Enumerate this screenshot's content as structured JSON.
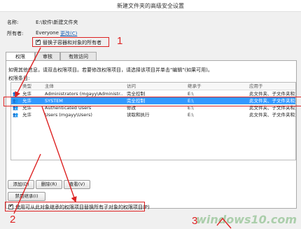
{
  "window": {
    "title": "新建文件夹的高级安全设置"
  },
  "general": {
    "name_label": "名称:",
    "name_value": "E:\\软件\\新建文件夹",
    "owner_label": "所有者:",
    "owner_value": "Everyone",
    "change_link": "更改(C)",
    "replace_owner_label": "替换子容器和对象的所有者",
    "replace_owner_checked": true
  },
  "tabs": [
    {
      "label": "权限",
      "active": true
    },
    {
      "label": "审核",
      "active": false
    },
    {
      "label": "有效访问",
      "active": false
    }
  ],
  "permissions": {
    "info_text": "如需其他信息，请双击权限项目。若要修改权限项目，请选择该项目并单击\"编辑\"(如果可用)。",
    "list_label": "权限条目:",
    "columns": [
      "类型",
      "主体",
      "访问",
      "继承于",
      "应用于"
    ],
    "rows": [
      {
        "type": "允许",
        "principal": "Administrators (mgayy\\Administr...",
        "access": "完全控制",
        "inherited": "E:\\",
        "applies": "此文件夹、子文件夹和文件",
        "selected": false
      },
      {
        "type": "允许",
        "principal": "SYSTEM",
        "access": "完全控制",
        "inherited": "E:\\",
        "applies": "此文件夹、子文件夹和文件",
        "selected": true
      },
      {
        "type": "允许",
        "principal": "Authenticated Users",
        "access": "修改",
        "inherited": "E:\\",
        "applies": "此文件夹、子文件夹和文件",
        "selected": false
      },
      {
        "type": "允许",
        "principal": "Users (mgayy\\Users)",
        "access": "读取和执行",
        "inherited": "E:\\",
        "applies": "此文件夹、子文件夹和文件",
        "selected": false
      }
    ],
    "add_button": "添加(D)",
    "delete_button": "删除(R)",
    "view_button": "查看(V)",
    "disable_inherit_button": "禁用继承(I)",
    "replace_all_label": "使用可从此对象继承的权限项目替换所有子对象的权限项目(P)",
    "replace_all_checked": true
  },
  "annotations": {
    "one": "1",
    "two": "2",
    "three": "3"
  },
  "watermark": "windows10.com",
  "colors": {
    "accent": "#3399ff",
    "annotation": "#dd2222"
  }
}
